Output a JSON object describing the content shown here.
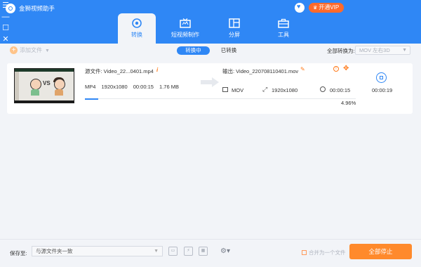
{
  "app": {
    "title": "金狮视频助手",
    "vip_label": "开通VIP"
  },
  "tabs": [
    {
      "label": "转换",
      "icon": "convert-icon",
      "active": true
    },
    {
      "label": "短视频制作",
      "icon": "tv-icon",
      "active": false
    },
    {
      "label": "分屏",
      "icon": "split-screen-icon",
      "active": false
    },
    {
      "label": "工具",
      "icon": "toolbox-icon",
      "active": false
    }
  ],
  "toolbar": {
    "add_file": "添加文件",
    "segment_active": "转换中",
    "segment_inactive": "已转换",
    "convert_all_label": "全部转换为:",
    "convert_all_value": "MOV 左右3D"
  },
  "item": {
    "source_label": "源文件: Video_22...0401.mp4",
    "source_format": "MP4",
    "source_resolution": "1920x1080",
    "source_duration": "00:00:15",
    "source_size": "1.76 MB",
    "output_label": "输出: Video_220708110401.mov",
    "output_format": "MOV",
    "output_resolution": "1920x1080",
    "output_duration": "00:00:15",
    "elapsed": "00:00:19",
    "progress_percent": 4.96,
    "progress_text": "4.96%"
  },
  "bottom": {
    "save_label": "保存至:",
    "save_path": "与源文件夹一致",
    "merge_label": "合并为一个文件",
    "stop_all": "全部停止"
  },
  "colors": {
    "header": "#2f87f5",
    "accent": "#2f87f5",
    "orange": "#ff8a2c"
  }
}
